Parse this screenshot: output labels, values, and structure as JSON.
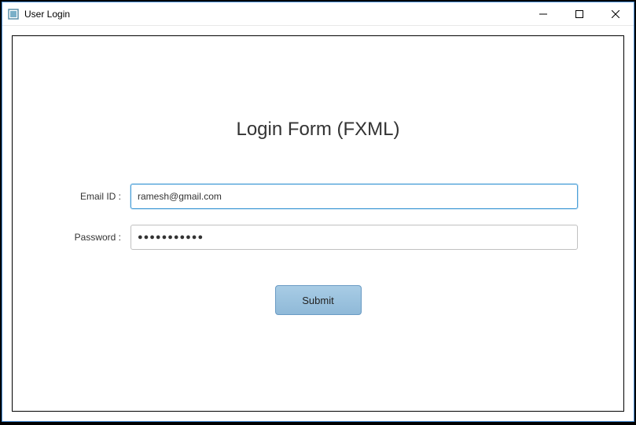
{
  "window": {
    "title": "User Login"
  },
  "form": {
    "heading": "Login Form (FXML)",
    "emailLabel": "Email ID :",
    "emailValue": "ramesh@gmail.com",
    "passwordLabel": "Password :",
    "passwordValue": "●●●●●●●●●●●",
    "submitLabel": "Submit"
  }
}
